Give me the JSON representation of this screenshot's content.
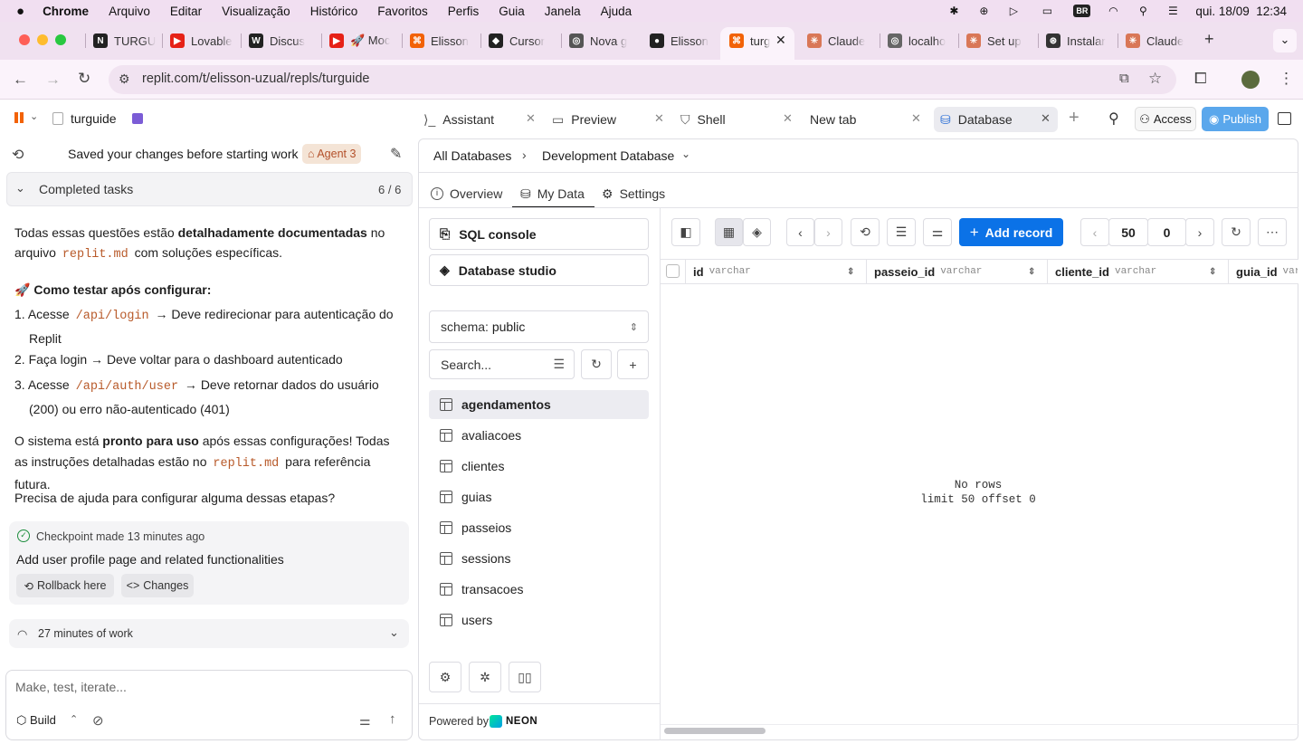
{
  "menubar": {
    "app": "Chrome",
    "items": [
      "Arquivo",
      "Editar",
      "Visualização",
      "Histórico",
      "Favoritos",
      "Perfis",
      "Guia",
      "Janela",
      "Ajuda"
    ],
    "input_source": "BR",
    "datetime": "qui. 18/09  12:34"
  },
  "browser_tabs": [
    {
      "title": "TURGU",
      "fav": "N",
      "color": "#222"
    },
    {
      "title": "Lovable",
      "fav": "▶",
      "color": "#e62117"
    },
    {
      "title": "Discus",
      "fav": "W",
      "color": "#222"
    },
    {
      "title": "🚀 Moc",
      "fav": "▶",
      "color": "#e62117"
    },
    {
      "title": "Elisson",
      "fav": "⌘",
      "color": "#f26207"
    },
    {
      "title": "Cursor",
      "fav": "◆",
      "color": "#222"
    },
    {
      "title": "Nova g",
      "fav": "◎",
      "color": "#555"
    },
    {
      "title": "Elisson",
      "fav": "●",
      "color": "#222"
    },
    {
      "title": "turg",
      "fav": "⌘",
      "color": "#f26207"
    },
    {
      "title": "Claude",
      "fav": "✳",
      "color": "#d97757"
    },
    {
      "title": "localho",
      "fav": "◎",
      "color": "#666"
    },
    {
      "title": "Set up",
      "fav": "✳",
      "color": "#d97757"
    },
    {
      "title": "Instalar",
      "fav": "⊛",
      "color": "#333"
    },
    {
      "title": "Claude",
      "fav": "✳",
      "color": "#d97757"
    }
  ],
  "address": {
    "url": "replit.com/t/elisson-uzual/repls/turguide"
  },
  "replit": {
    "repl_name": "turguide",
    "workspace_tabs": [
      {
        "label": "Assistant"
      },
      {
        "label": "Preview"
      },
      {
        "label": "Shell"
      },
      {
        "label": "New tab"
      },
      {
        "label": "Database"
      }
    ],
    "access_label": "Access",
    "publish_label": "Publish"
  },
  "chat": {
    "status": "Saved your changes before starting work",
    "agent_badge": "Agent 3",
    "completed_label": "Completed tasks",
    "completed_count": "6 / 6",
    "p1_a": "Todas essas questões estão ",
    "p1_b": "detalhadamente documentadas",
    "p1_c": " no arquivo ",
    "p1_code": "replit.md",
    "p1_d": " com soluções específicas.",
    "heading_emoji": "🚀",
    "heading": "Como testar após configurar:",
    "steps": [
      {
        "n": "1.",
        "a": "Acesse ",
        "code": "/api/login",
        "b": " → Deve redirecionar para autenticação do Replit"
      },
      {
        "n": "2.",
        "a": "Faça login → Deve voltar para o dashboard autenticado",
        "code": "",
        "b": ""
      },
      {
        "n": "3.",
        "a": "Acesse ",
        "code": "/api/auth/user",
        "b": " → Deve retornar dados do usuário (200) ou erro não-autenticado (401)"
      }
    ],
    "p2_a": "O sistema está ",
    "p2_b": "pronto para uso",
    "p2_c": " após essas configurações! Todas as instruções detalhadas estão no ",
    "p2_code": "replit.md",
    "p2_d": " para referência futura.",
    "p3": "Precisa de ajuda para configurar alguma dessas etapas?",
    "checkpoint_label": "Checkpoint made",
    "checkpoint_time": "13 minutes ago",
    "checkpoint_desc": "Add user profile page and related functionalities",
    "rollback_label": "Rollback here",
    "changes_label": "Changes",
    "work_label": "27 minutes of work",
    "input_placeholder": "Make, test, iterate...",
    "mode_label": "Build"
  },
  "db": {
    "breadcrumb_root": "All Databases",
    "breadcrumb_current": "Development Database",
    "subtabs": [
      "Overview",
      "My Data",
      "Settings"
    ],
    "sql_console": "SQL console",
    "db_studio": "Database studio",
    "schema_label": "schema:",
    "schema_value": "public",
    "search_placeholder": "Search...",
    "tables": [
      "agendamentos",
      "avaliacoes",
      "clientes",
      "guias",
      "passeios",
      "sessions",
      "transacoes",
      "users"
    ],
    "selected_table": "agendamentos",
    "powered_by": "Powered by",
    "neon": "NEON",
    "add_record": "Add record",
    "limit": "50",
    "offset": "0",
    "columns": [
      {
        "name": "id",
        "type": "varchar"
      },
      {
        "name": "passeio_id",
        "type": "varchar"
      },
      {
        "name": "cliente_id",
        "type": "varchar"
      },
      {
        "name": "guia_id",
        "type": "varchar"
      }
    ],
    "empty_1": "No rows",
    "empty_2": "limit 50 offset 0"
  },
  "colors": {
    "accent": "#0b72e7",
    "publish": "#5aa7ec",
    "agent": "#f4e4d6"
  }
}
